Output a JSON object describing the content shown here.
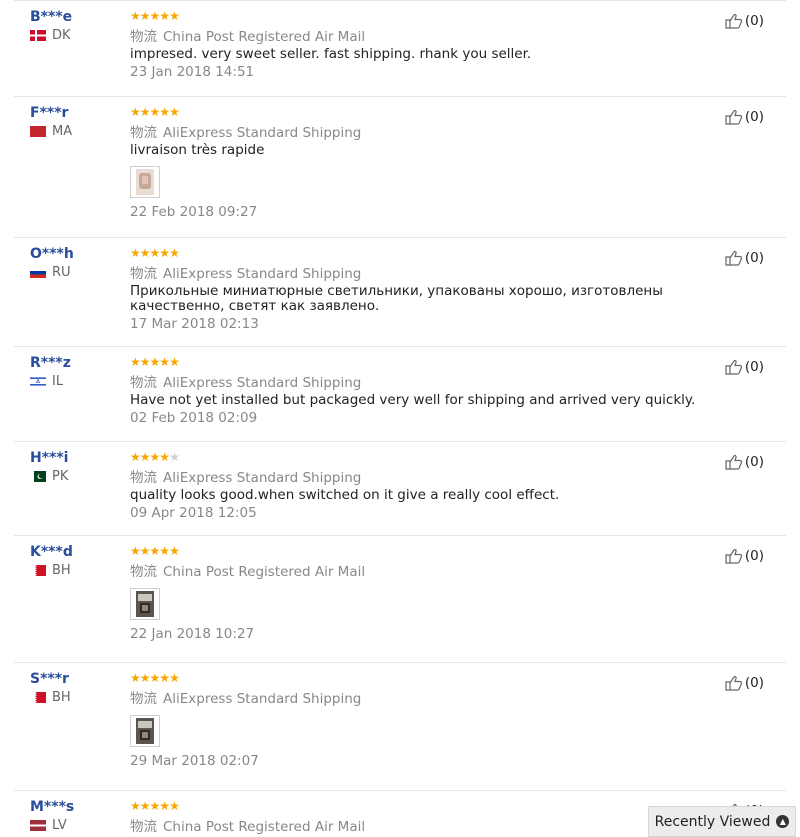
{
  "reviews": [
    {
      "user": "B***e",
      "country": "DK",
      "flag": "flag-dk",
      "rating": 5,
      "logistics": "物流",
      "shipping": "China Post Registered Air Mail",
      "text": "impresed. very sweet seller. fast shipping. rhank you seller.",
      "photo": false,
      "date": "23 Jan 2018 14:51",
      "helpful": "(0)"
    },
    {
      "user": "F***r",
      "country": "MA",
      "flag": "flag-ma",
      "rating": 5,
      "logistics": "物流",
      "shipping": "AliExpress Standard Shipping",
      "text": "livraison très rapide",
      "photo": true,
      "photo_icon": "photo-light",
      "date": "22 Feb 2018 09:27",
      "helpful": "(0)"
    },
    {
      "user": "O***h",
      "country": "RU",
      "flag": "flag-ru",
      "rating": 5,
      "logistics": "物流",
      "shipping": "AliExpress Standard Shipping",
      "text": "Прикольные миниатюрные светильники, упакованы хорошо, изготовлены качественно, светят как заявлено.",
      "photo": false,
      "date": "17 Mar 2018 02:13",
      "helpful": "(0)"
    },
    {
      "user": "R***z",
      "country": "IL",
      "flag": "flag-il",
      "rating": 5,
      "logistics": "物流",
      "shipping": "AliExpress Standard Shipping",
      "text": "Have not yet installed but packaged very well for shipping and arrived very quickly.",
      "photo": false,
      "date": "02 Feb 2018 02:09",
      "helpful": "(0)"
    },
    {
      "user": "H***i",
      "country": "PK",
      "flag": "flag-pk",
      "rating": 4,
      "logistics": "物流",
      "shipping": "AliExpress Standard Shipping",
      "text": "quality looks good.when switched on it give a really cool effect.",
      "photo": false,
      "date": "09 Apr 2018 12:05",
      "helpful": "(0)"
    },
    {
      "user": "K***d",
      "country": "BH",
      "flag": "flag-bh",
      "rating": 5,
      "logistics": "物流",
      "shipping": "China Post Registered Air Mail",
      "text": "",
      "photo": true,
      "photo_icon": "photo-dark",
      "date": "22 Jan 2018 10:27",
      "helpful": "(0)"
    },
    {
      "user": "S***r",
      "country": "BH",
      "flag": "flag-bh",
      "rating": 5,
      "logistics": "物流",
      "shipping": "AliExpress Standard Shipping",
      "text": "",
      "photo": true,
      "photo_icon": "photo-dark",
      "date": "29 Mar 2018 02:07",
      "helpful": "(0)"
    },
    {
      "user": "M***s",
      "country": "LV",
      "flag": "flag-lv",
      "rating": 5,
      "logistics": "物流",
      "shipping": "China Post Registered Air Mail",
      "text": "",
      "photo": false,
      "date": "",
      "helpful": "(0)"
    }
  ],
  "recently_viewed": {
    "label": "Recently Viewed",
    "icon": "chevron-up-icon"
  },
  "colors": {
    "username": "#2a4d9b",
    "star": "#f7a600",
    "star_off": "#cfcfcf",
    "meta": "#888888"
  }
}
